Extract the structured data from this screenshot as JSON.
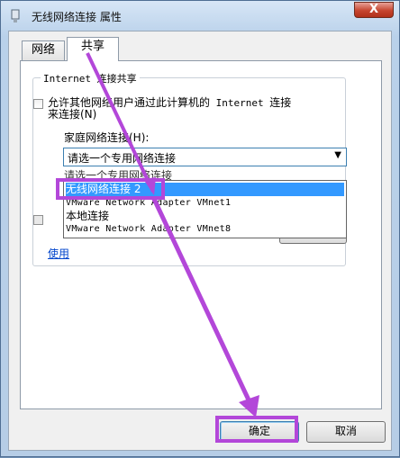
{
  "window": {
    "title": "无线网络连接 属性",
    "close_label": "X"
  },
  "tabs": [
    {
      "label": "网络"
    },
    {
      "label": "共享"
    }
  ],
  "sharing": {
    "group_title": "Internet 连接共享",
    "allow_checkbox_label_line1": "允许其他网络用户通过此计算机的",
    "allow_checkbox_label_mono": " Internet ",
    "allow_checkbox_label_tail": "连接",
    "allow_checkbox_label_line2": "来连接(N)",
    "home_network_label": "家庭网络连接(H):",
    "combo_selected": "请选一个专用网络连接",
    "behind_list_text": "请选一个专用网络连接",
    "dropdown_options": [
      "无线网络连接 2",
      "VMware Network Adapter VMnet1",
      "本地连接",
      "VMware Network Adapter VMnet8"
    ],
    "use_link": "使用"
  },
  "buttons": {
    "ok": "确定",
    "cancel": "取消"
  },
  "colors": {
    "annotation": "#b347d9",
    "selection": "#3399ff"
  }
}
